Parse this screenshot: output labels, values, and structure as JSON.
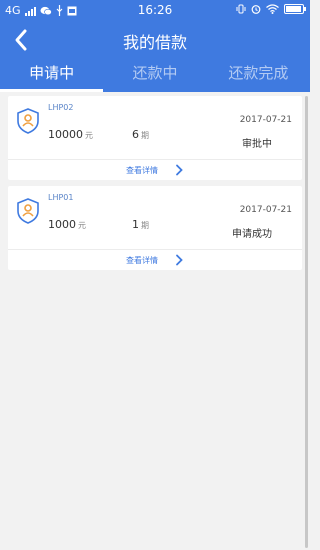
{
  "status_bar": {
    "network": "4G",
    "time": "16:26"
  },
  "header": {
    "title": "我的借款"
  },
  "tabs": [
    {
      "label": "申请中",
      "active": true
    },
    {
      "label": "还款中",
      "active": false
    },
    {
      "label": "还款完成",
      "active": false
    }
  ],
  "loans": [
    {
      "code": "LHP02",
      "amount": "10000",
      "amount_unit": "元",
      "periods": "6",
      "periods_unit": "期",
      "date": "2017-07-21",
      "status": "审批中",
      "detail_label": "查看详情"
    },
    {
      "code": "LHP01",
      "amount": "1000",
      "amount_unit": "元",
      "periods": "1",
      "periods_unit": "期",
      "date": "2017-07-21",
      "status": "申请成功",
      "detail_label": "查看详情"
    }
  ],
  "colors": {
    "primary": "#3f7ae0",
    "badge_shield": "#3f7ae0",
    "badge_user": "#f0a040"
  },
  "icons": {
    "back": "chevron-left-icon",
    "badge": "shield-user-icon",
    "detail": "chevron-right-icon"
  }
}
